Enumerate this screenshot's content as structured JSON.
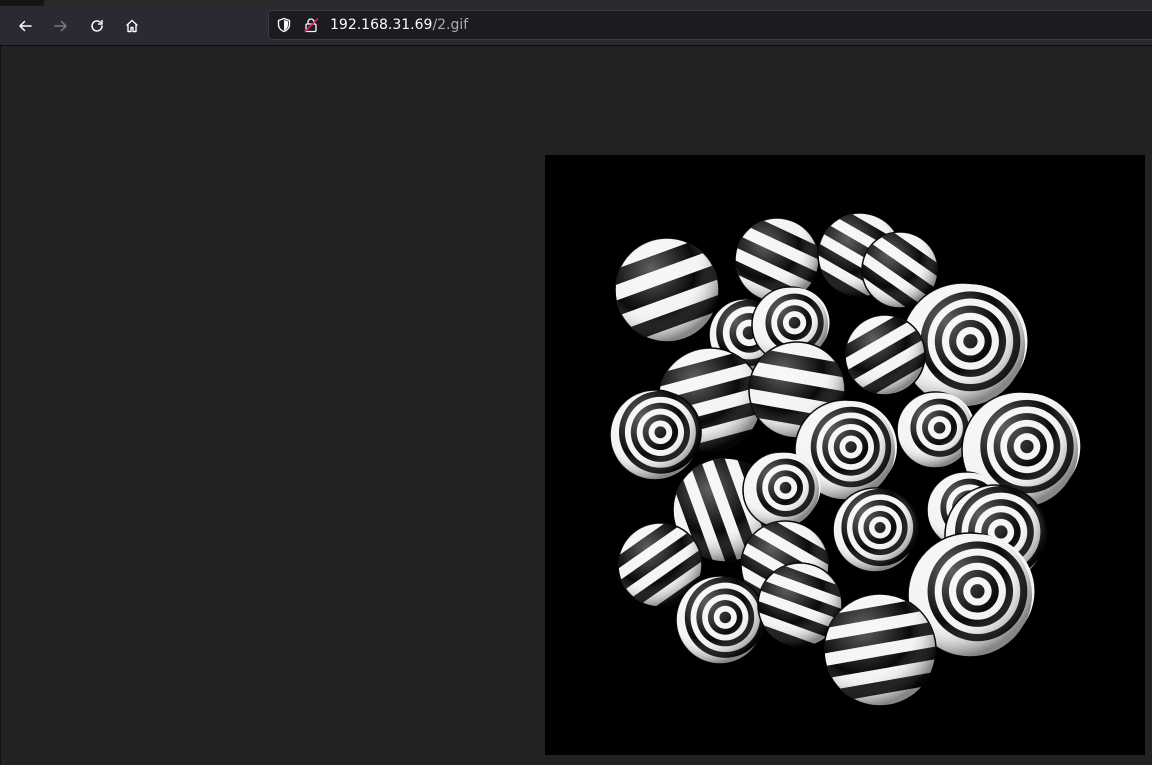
{
  "browser": {
    "url": {
      "host": "192.168.31.69",
      "path": "/2.gif"
    },
    "nav": {
      "back_icon": "arrow-left",
      "forward_icon": "arrow-right",
      "reload_icon": "reload",
      "home_icon": "home"
    },
    "security_icons": [
      "shield-icon",
      "insecure-lock-icon"
    ]
  },
  "content": {
    "image_description_icon": "striped-spheres-gif"
  },
  "colors": {
    "page_background": "#222222",
    "toolbar": "#2b2a33",
    "urlbar": "#1c1b22",
    "image_background": "#000000",
    "insecure_accent": "#e22850"
  }
}
